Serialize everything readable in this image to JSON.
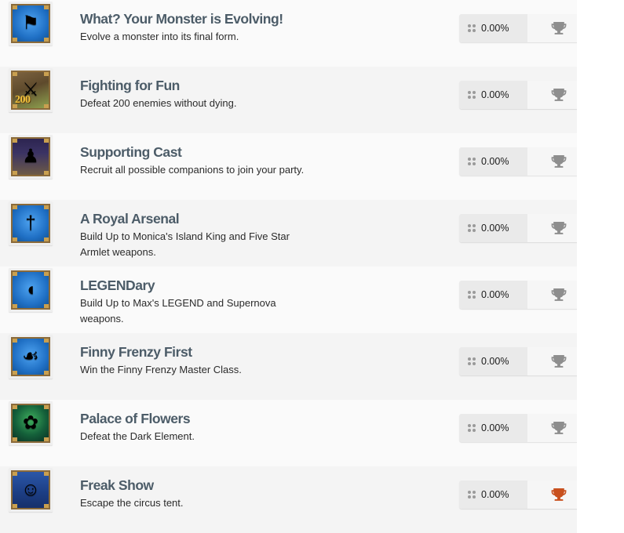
{
  "list": {
    "name": "achievement-list",
    "progress_icon": "grid-dots-icon",
    "trophy_icon": "trophy-icon",
    "trophy_color_locked": "#8e8e8e",
    "trophy_color_earned": "#c8501e",
    "row_bg_odd": "#fafafa",
    "row_bg_even": "#f4f4f4",
    "title_color": "#4c5c68",
    "items": [
      {
        "title": "What? Your Monster is Evolving!",
        "description": "Evolve a monster into its final form.",
        "progress": "0.00%",
        "trophy_state": "locked",
        "icon_name": "treasure-chest-monster-icon",
        "icon_glyph": "⚑",
        "icon_badge": ""
      },
      {
        "title": "Fighting for Fun",
        "description": "Defeat 200 enemies without dying.",
        "progress": "0.00%",
        "trophy_state": "locked",
        "icon_name": "boulder-hero-icon",
        "icon_glyph": "⚔",
        "icon_badge": "200"
      },
      {
        "title": "Supporting Cast",
        "description": "Recruit all possible companions to join your party.",
        "progress": "0.00%",
        "trophy_state": "locked",
        "icon_name": "party-companions-icon",
        "icon_glyph": "♟",
        "icon_badge": ""
      },
      {
        "title": "A Royal Arsenal",
        "description": "Build Up to Monica's Island King and Five Star Armlet weapons.",
        "progress": "0.00%",
        "trophy_state": "locked",
        "icon_name": "island-king-sword-icon",
        "icon_glyph": "†",
        "icon_badge": ""
      },
      {
        "title": "LEGENDary",
        "description": "Build Up to Max's LEGEND and Supernova weapons.",
        "progress": "0.00%",
        "trophy_state": "locked",
        "icon_name": "supernova-cannon-icon",
        "icon_glyph": "◖",
        "icon_badge": ""
      },
      {
        "title": "Finny Frenzy First",
        "description": "Win the Finny Frenzy Master Class.",
        "progress": "0.00%",
        "trophy_state": "locked",
        "icon_name": "fish-trophy-icon",
        "icon_glyph": "☙",
        "icon_badge": ""
      },
      {
        "title": "Palace of Flowers",
        "description": "Defeat the Dark Element.",
        "progress": "0.00%",
        "trophy_state": "locked",
        "icon_name": "dark-element-icon",
        "icon_glyph": "✿",
        "icon_badge": ""
      },
      {
        "title": "Freak Show",
        "description": "Escape the circus tent.",
        "progress": "0.00%",
        "trophy_state": "earned",
        "icon_name": "clown-icon",
        "icon_glyph": "☺",
        "icon_badge": ""
      }
    ]
  }
}
